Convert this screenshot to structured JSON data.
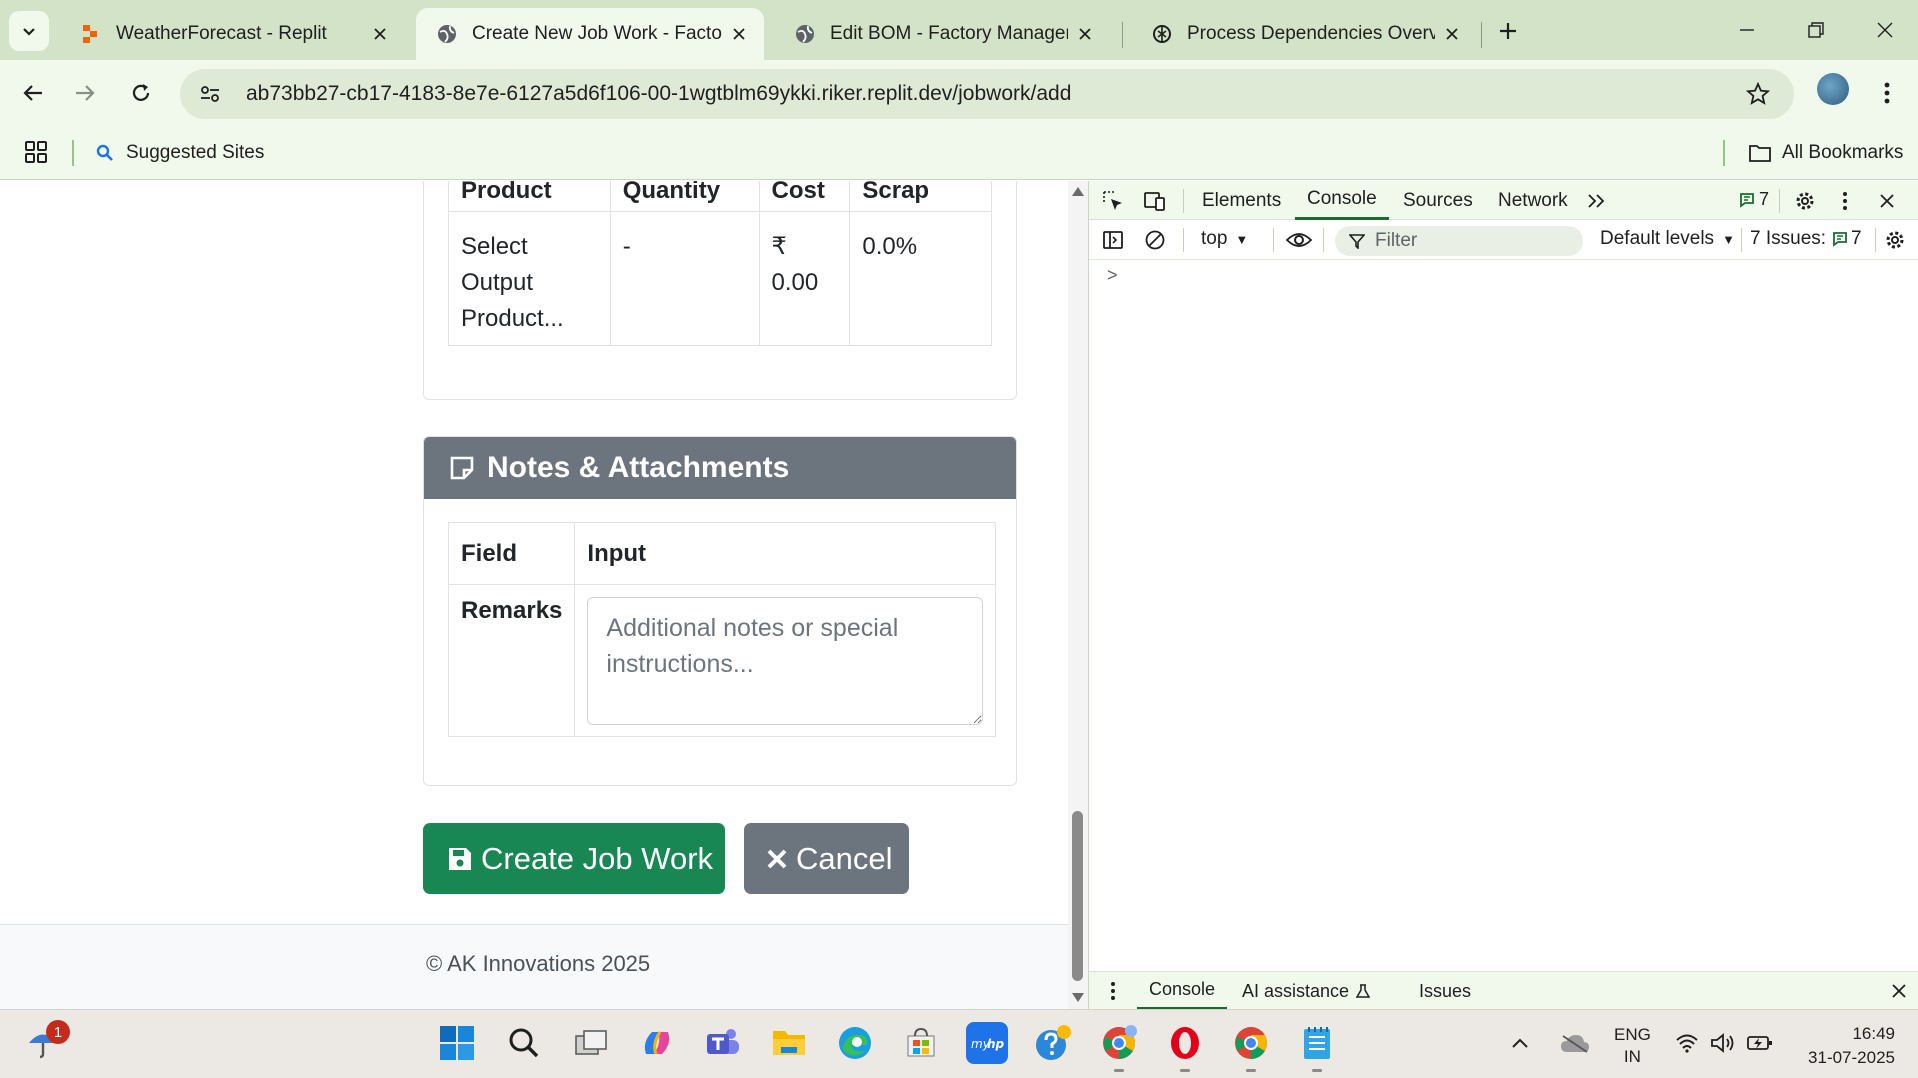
{
  "browser": {
    "tabs": [
      {
        "title": "WeatherForecast - Replit",
        "icon": "replit-icon",
        "active": false
      },
      {
        "title": "Create New Job Work - Factory",
        "icon": "globe-icon",
        "active": true
      },
      {
        "title": "Edit BOM - Factory Managemen",
        "icon": "globe-icon",
        "active": false
      },
      {
        "title": "Process Dependencies Overview",
        "icon": "chatgpt-icon",
        "active": false
      }
    ],
    "url": "ab73bb27-cb17-4183-8e7e-6127a5d6f106-00-1wgtblm69ykki.riker.replit.dev/jobwork/add",
    "bookmarks": {
      "suggested": "Suggested Sites",
      "all": "All Bookmarks"
    }
  },
  "page": {
    "product_table": {
      "headers": [
        "Product",
        "Quantity",
        "Cost",
        "Scrap"
      ],
      "row": {
        "product_line1": "Select",
        "product_line2": "Output",
        "product_line3": "Product...",
        "quantity": "-",
        "cost": "₹ 0.00",
        "scrap": "0.0%"
      }
    },
    "notes": {
      "title": "Notes & Attachments",
      "headers": [
        "Field",
        "Input"
      ],
      "remarks_label": "Remarks",
      "remarks_placeholder": "Additional notes or special instructions..."
    },
    "buttons": {
      "create": "Create Job Work",
      "cancel": "Cancel"
    },
    "footer": "© AK Innovations 2025"
  },
  "devtools": {
    "tabs": [
      "Elements",
      "Console",
      "Sources",
      "Network"
    ],
    "active_tab": "Console",
    "message_count": "7",
    "context": "top",
    "filter_placeholder": "Filter",
    "levels": "Default levels",
    "issues_label": "7 Issues:",
    "issues_count": "7",
    "prompt": ">",
    "drawer_tabs": {
      "console": "Console",
      "ai": "AI assistance",
      "issues": "Issues"
    }
  },
  "taskbar": {
    "weather_badge": "1",
    "lang_line1": "ENG",
    "lang_line2": "IN",
    "time": "16:49",
    "date": "31-07-2025"
  },
  "colors": {
    "accent_green": "#198754",
    "secondary_gray": "#6c757d",
    "chrome_bg": "#d3e3c7"
  }
}
